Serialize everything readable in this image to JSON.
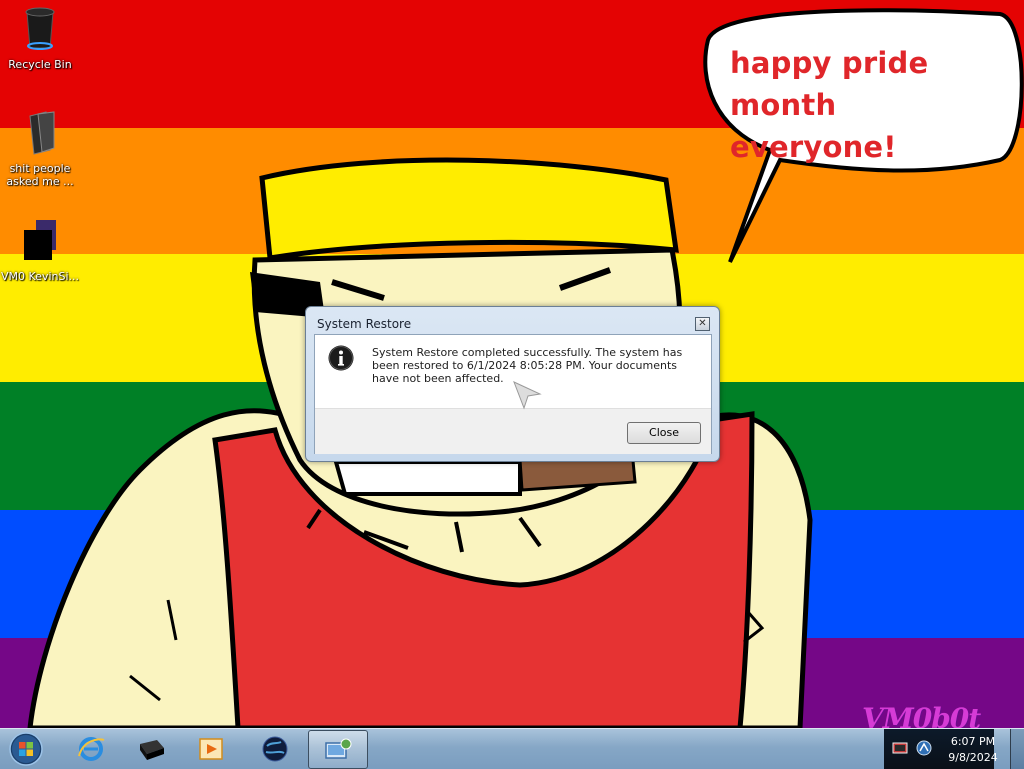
{
  "desktop": {
    "icons": [
      {
        "label": "Recycle Bin",
        "icon": "recycle-bin-icon"
      },
      {
        "label": "shit people asked me ...",
        "icon": "folder-icon"
      },
      {
        "label": "VM0 KevinSi...",
        "icon": "shortcut-icon"
      }
    ],
    "speech_line1": "happy pride month",
    "speech_line2": "everyone!",
    "watermark": "VM0b0t"
  },
  "dialog": {
    "title": "System Restore",
    "close_glyph": "✕",
    "message": "System Restore completed successfully. The system has been restored to 6/1/2024 8:05:28 PM. Your documents have not been affected.",
    "button_label": "Close"
  },
  "taskbar": {
    "items": [
      {
        "icon": "internet-explorer-icon"
      },
      {
        "icon": "black-box-app-icon"
      },
      {
        "icon": "media-player-icon"
      },
      {
        "icon": "globe-app-icon"
      },
      {
        "icon": "system-restore-icon",
        "active": true
      }
    ],
    "clock_time": "6:07 PM",
    "clock_date": "9/8/2024"
  },
  "colors": {
    "rainbow": [
      "#e40303",
      "#ff8c00",
      "#ffed00",
      "#008026",
      "#004dff",
      "#750787"
    ],
    "speech_text": "#e0262a",
    "watermark": "#d63bd6"
  }
}
